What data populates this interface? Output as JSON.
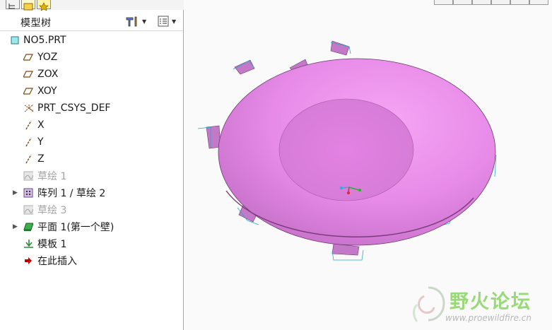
{
  "model_tree": {
    "title": "模型树",
    "items": [
      {
        "label": "NO5.PRT",
        "icon": "part-icon",
        "expand": ""
      },
      {
        "label": "YOZ",
        "icon": "datum-plane-icon",
        "expand": ""
      },
      {
        "label": "ZOX",
        "icon": "datum-plane-icon",
        "expand": ""
      },
      {
        "label": "XOY",
        "icon": "datum-plane-icon",
        "expand": ""
      },
      {
        "label": "PRT_CSYS_DEF",
        "icon": "coordinate-system-icon",
        "expand": ""
      },
      {
        "label": "X",
        "icon": "datum-axis-icon",
        "expand": ""
      },
      {
        "label": "Y",
        "icon": "datum-axis-icon",
        "expand": ""
      },
      {
        "label": "Z",
        "icon": "datum-axis-icon",
        "expand": ""
      },
      {
        "label": "草绘 1",
        "icon": "sketch-icon",
        "expand": ""
      },
      {
        "label": "阵列 1 / 草绘 2",
        "icon": "pattern-icon",
        "expand": "▶"
      },
      {
        "label": "草绘 3",
        "icon": "sketch-icon",
        "expand": ""
      },
      {
        "label": "平面 1(第一个壁)",
        "icon": "flat-wall-icon",
        "expand": "▶"
      },
      {
        "label": "模板 1",
        "icon": "form-icon",
        "expand": ""
      },
      {
        "label": "在此插入",
        "icon": "insert-here-arrow-icon",
        "expand": ""
      }
    ]
  },
  "watermark": {
    "title": "野火论坛",
    "url": "www.proewildfire.cn"
  },
  "colors": {
    "part_pink": "#ee88ee",
    "sketch_gray": "#a3a3a3",
    "watermark_green": "#8ed66a",
    "insert_arrow": "#c00000"
  }
}
